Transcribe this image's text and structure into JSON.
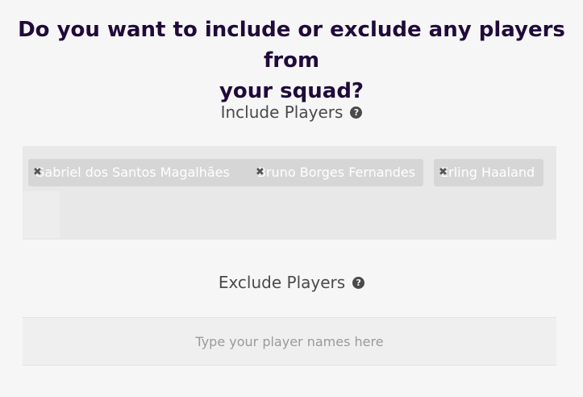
{
  "question": {
    "line1": "Do you want to include or exclude any players from",
    "line2": "your squad?"
  },
  "include": {
    "label": "Include Players",
    "help_icon": "question-circle-icon",
    "tags": [
      {
        "name": "Gabriel dos Santos Magalhães"
      },
      {
        "name": "Bruno Borges Fernandes"
      },
      {
        "name": "Erling Haaland"
      }
    ]
  },
  "exclude": {
    "label": "Exclude Players",
    "help_icon": "question-circle-icon",
    "placeholder": "Type your player names here",
    "value": ""
  },
  "colors": {
    "title": "#1f0a3a",
    "background": "#f6f6f6",
    "tag_bg": "#d6d6d6"
  }
}
